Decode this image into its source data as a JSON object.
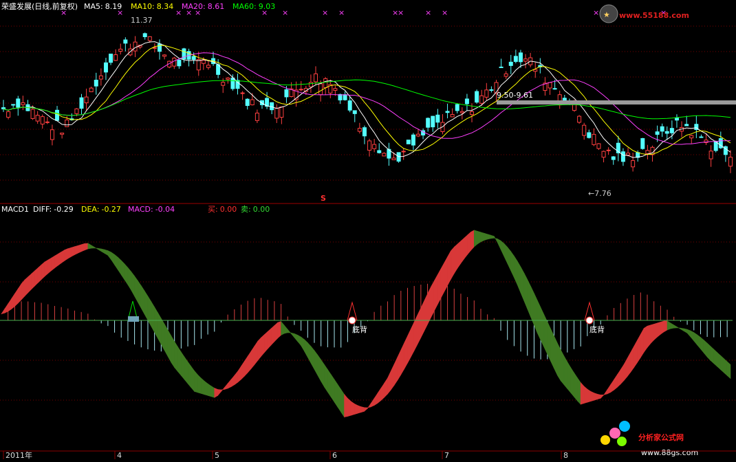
{
  "header": {
    "stock": "荣盛发展(日线,前复权)",
    "ma5_label": "MA5:",
    "ma5_value": "8.19",
    "ma10_label": "MA10:",
    "ma10_value": "8.34",
    "ma20_label": "MA20:",
    "ma20_value": "8.61",
    "ma60_label": "MA60:",
    "ma60_value": "9.03"
  },
  "logo_top": "www.55188.com",
  "logo_bottom_cn": "分析家公式网",
  "logo_bottom_url": "www.88gs.com",
  "annotations": {
    "high_price": "11.37",
    "low_price": "←7.76",
    "range_text": "9.50-9.61",
    "s_marker": "S",
    "bottom_div_1": "底背",
    "bottom_div_2": "底背"
  },
  "macd_header": {
    "name": "MACD1",
    "diff_label": "DIFF:",
    "diff_value": "-0.29",
    "dea_label": "DEA:",
    "dea_value": "-0.27",
    "macd_label": "MACD:",
    "macd_value": "-0.04",
    "buy_label": "买:",
    "buy_value": "0.00",
    "sell_label": "卖:",
    "sell_value": "0.00"
  },
  "time_axis": [
    "2011年",
    "4",
    "5",
    "6",
    "7",
    "8"
  ],
  "colors": {
    "up": "#ff4040",
    "down": "#54ffff",
    "ma5": "#ffffff",
    "ma10": "#ffff00",
    "ma20": "#ff40ff",
    "ma60": "#00ff00",
    "grid": "#7a0000",
    "macd_red": "#d83838",
    "macd_green": "#3f7a22"
  },
  "chart_data": [
    {
      "type": "candlestick",
      "title": "荣盛发展(日线,前复权)",
      "price_range_visible": [
        7.5,
        11.7
      ],
      "high": 11.37,
      "low": 7.76,
      "close_sample": [
        9.3,
        9.5,
        9.2,
        8.9,
        8.8,
        9.4,
        10.0,
        10.6,
        10.9,
        11.1,
        10.8,
        10.5,
        10.4,
        10.6,
        10.2,
        9.9,
        9.4,
        9.3,
        9.5,
        9.8,
        10.1,
        10.0,
        9.6,
        8.9,
        8.5,
        8.0,
        8.2,
        8.6,
        8.9,
        9.1,
        9.3,
        9.6,
        10.1,
        10.6,
        10.5,
        10.1,
        9.7,
        9.3,
        8.6,
        8.2,
        8.0,
        8.2,
        8.4,
        8.8,
        8.9,
        8.6,
        8.3,
        8.1
      ],
      "series": [
        {
          "name": "MA5",
          "last": 8.19
        },
        {
          "name": "MA10",
          "last": 8.34
        },
        {
          "name": "MA20",
          "last": 8.61
        },
        {
          "name": "MA60",
          "last": 9.03
        }
      ]
    },
    {
      "type": "area",
      "title": "MACD1",
      "diff_sample": [
        0.02,
        0.12,
        0.18,
        0.22,
        0.24,
        0.2,
        0.1,
        -0.02,
        -0.14,
        -0.22,
        -0.24,
        -0.16,
        -0.06,
        0.0,
        -0.08,
        -0.2,
        -0.3,
        -0.28,
        -0.18,
        -0.04,
        0.1,
        0.22,
        0.28,
        0.26,
        0.12,
        -0.04,
        -0.18,
        -0.26,
        -0.24,
        -0.14,
        -0.02,
        0.0,
        -0.04,
        -0.12,
        -0.18
      ],
      "values_last": {
        "DIFF": -0.29,
        "DEA": -0.27,
        "MACD": -0.04
      }
    }
  ]
}
